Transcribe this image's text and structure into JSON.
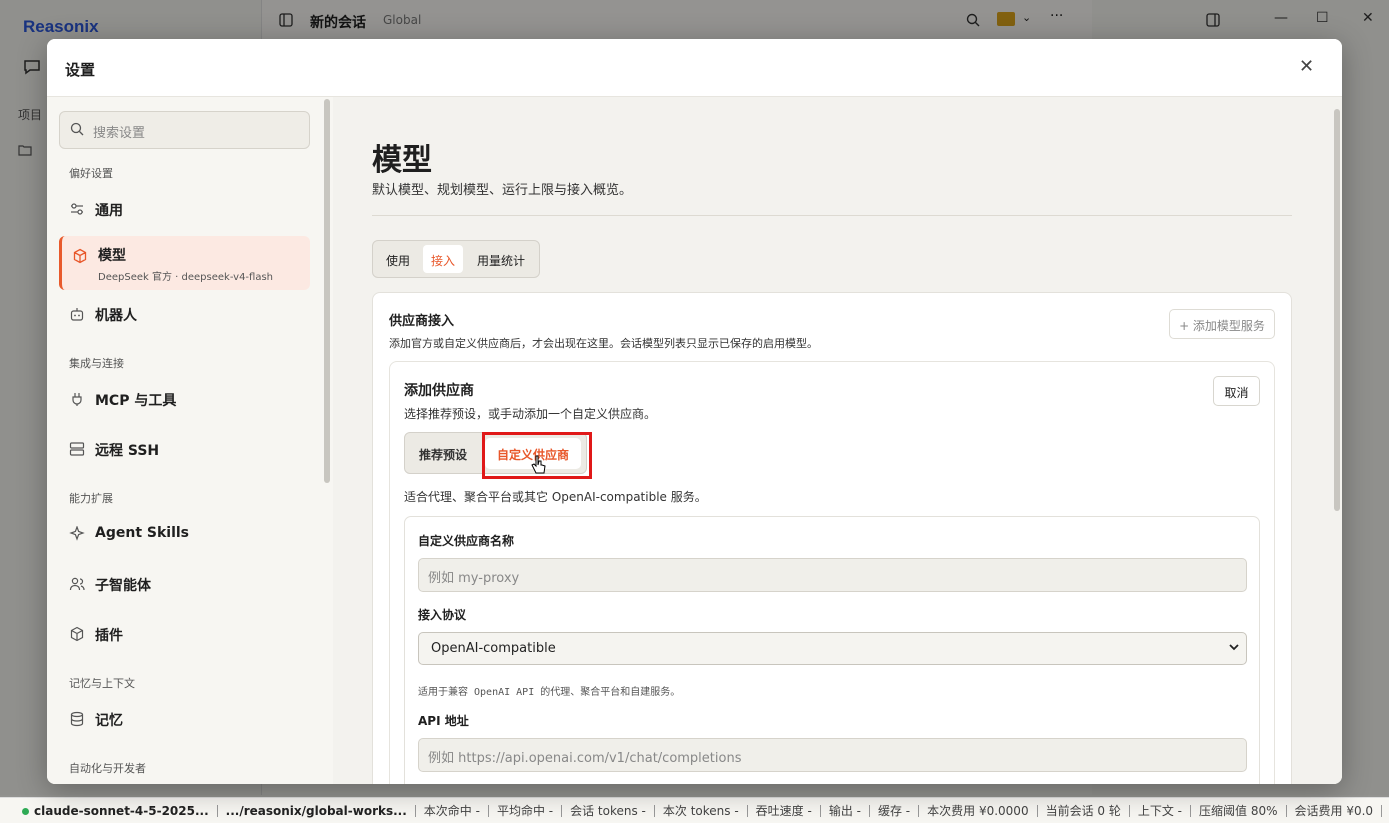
{
  "app": {
    "logo": "Reasonix",
    "conversation_title": "新的会话",
    "workspace": "Global",
    "projects_label": "项目"
  },
  "status_bar": {
    "model": "claude-sonnet-4-5-2025...",
    "path": ".../reasonix/global-works...",
    "hit_this": "本次命中 -",
    "hit_avg": "平均命中 -",
    "session_tokens": "会话 tokens -",
    "this_tokens": "本次 tokens -",
    "throughput": "吞吐速度 -",
    "output": "输出 -",
    "cache": "缓存 -",
    "this_cost": "本次费用 ¥0.0000",
    "current_session": "当前会话 0 轮",
    "context": "上下文 -",
    "compress_threshold": "压缩阈值 80%",
    "session_cost": "会话费用 ¥0.0"
  },
  "settings": {
    "title": "设置",
    "search_placeholder": "搜索设置",
    "sections": [
      {
        "label": "偏好设置"
      },
      {
        "label": "集成与连接"
      },
      {
        "label": "能力扩展"
      },
      {
        "label": "记忆与上下文"
      },
      {
        "label": "自动化与开发者"
      }
    ],
    "items": [
      {
        "label": "通用",
        "icon": "sliders-icon"
      },
      {
        "label": "模型",
        "icon": "cube-icon",
        "sub": "DeepSeek 官方 · deepseek-v4-flash"
      },
      {
        "label": "机器人",
        "icon": "robot-icon"
      },
      {
        "label": "MCP 与工具",
        "icon": "plug-icon"
      },
      {
        "label": "远程 SSH",
        "icon": "server-icon"
      },
      {
        "label": "Agent Skills",
        "icon": "sparkle-icon"
      },
      {
        "label": "子智能体",
        "icon": "users-icon"
      },
      {
        "label": "插件",
        "icon": "package-icon"
      },
      {
        "label": "记忆",
        "icon": "database-icon"
      }
    ]
  },
  "main": {
    "title": "模型",
    "description": "默认模型、规划模型、运行上限与接入概览。",
    "tabs": [
      "使用",
      "接入",
      "用量统计"
    ],
    "active_tab": "接入",
    "provider_card": {
      "title": "供应商接入",
      "description": "添加官方或自定义供应商后，才会出现在这里。会话模型列表只显示已保存的启用模型。",
      "add_button": "+ 添加模型服务"
    },
    "add_provider": {
      "title": "添加供应商",
      "description": "选择推荐预设，或手动添加一个自定义供应商。",
      "cancel": "取消",
      "segments": [
        "推荐预设",
        "自定义供应商"
      ],
      "active_segment": "自定义供应商",
      "segment_description": "适合代理、聚合平台或其它 OpenAI-compatible 服务。",
      "form": {
        "name_label": "自定义供应商名称",
        "name_placeholder": "例如 my-proxy",
        "protocol_label": "接入协议",
        "protocol_value": "OpenAI-compatible",
        "protocol_hint": "适用于兼容 OpenAI API 的代理、聚合平台和自建服务。",
        "api_label": "API 地址",
        "api_placeholder": "例如 https://api.openai.com/v1/chat/completions"
      }
    }
  },
  "colors": {
    "accent": "#e8572a",
    "highlight": "#e01818",
    "brand": "#2a55d6"
  }
}
